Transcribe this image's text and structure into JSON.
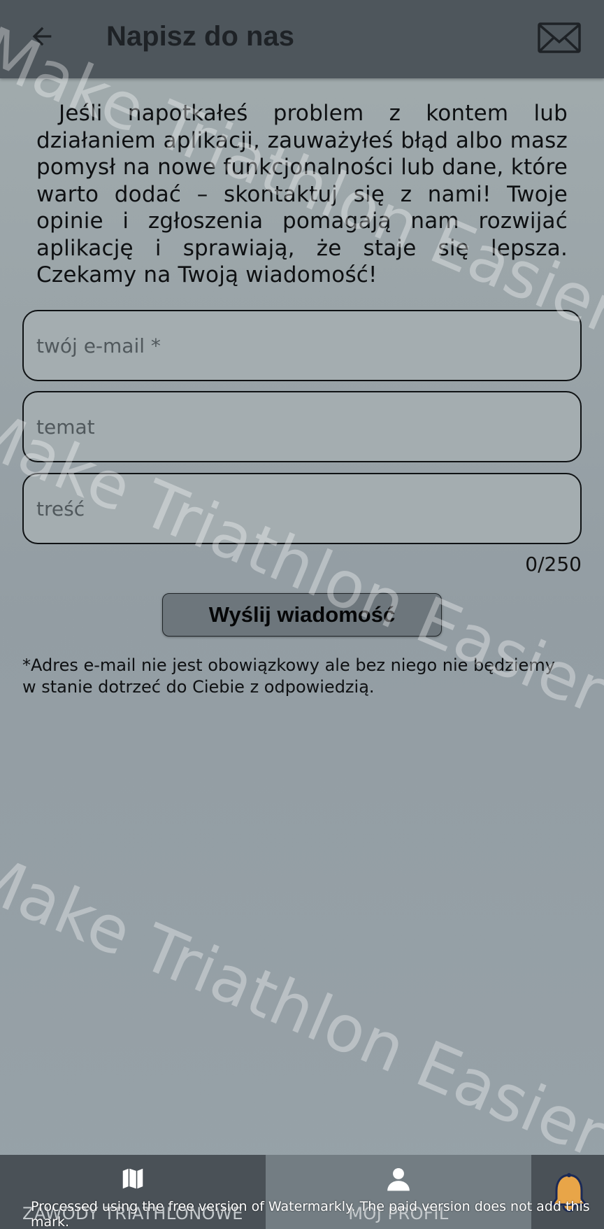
{
  "header": {
    "title": "Napisz do nas",
    "back_icon": "arrow-back-icon",
    "mail_icon": "envelope-icon"
  },
  "intro_text": "Jeśli napotkałeś problem z kontem lub działaniem aplikacji, zauważyłeś błąd albo masz pomysł na nowe funkcjonalności lub dane, które warto dodać – skontaktuj się z nami! Twoje opinie i zgłoszenia pomagają nam rozwijać aplikację i sprawiają, że staje się lepsza. Czekamy na Twoją wiadomość!",
  "form": {
    "email_placeholder": "twój e-mail *",
    "email_value": "",
    "subject_placeholder": "temat",
    "subject_value": "",
    "body_placeholder": "treść",
    "body_value": "",
    "counter": "0/250",
    "send_label": "Wyślij wiadomość",
    "note": "*Adres e-mail nie jest obowiązkowy ale bez niego nie będziemy w stanie dotrzeć do Ciebie z odpowiedzią."
  },
  "watermark": {
    "text": "Make Triathlon Easier",
    "notice": "Processed using the free version of Watermarkly. The paid version does not add this mark."
  },
  "bottom_nav": {
    "tabs": [
      {
        "label": "ZAWODY TRIATHLONOWE",
        "icon": "map-icon",
        "active": false
      },
      {
        "label": "MÓJ PROFIL",
        "icon": "person-icon",
        "active": true
      }
    ],
    "bell_icon": "bell-icon"
  },
  "colors": {
    "header_bg": "#4e565c",
    "page_bg": "#9aa4a8",
    "field_bg": "#a4adb0",
    "button_bg": "#6d767c",
    "nav_bg": "#4a5157",
    "nav_active_bg": "#737d83",
    "bell": "#e8a548"
  }
}
